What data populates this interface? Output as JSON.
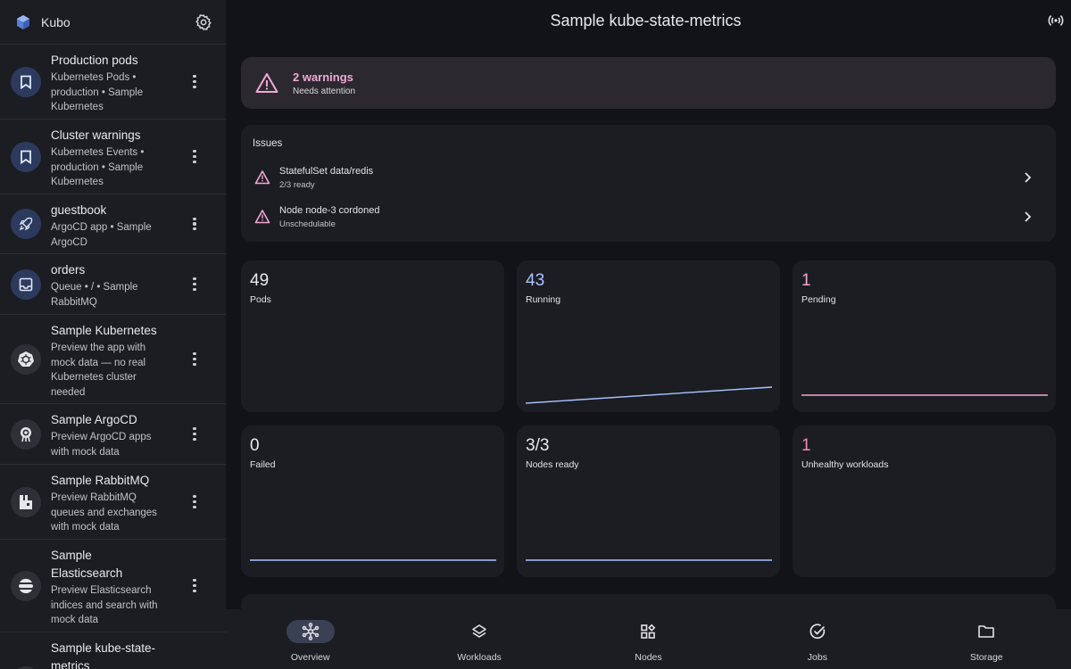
{
  "sidebar": {
    "app_name": "Kubo",
    "items": [
      {
        "title": "Production pods",
        "subtitle": "Kubernetes Pods • production • Sample Kubernetes",
        "icon": "bookmark-icon"
      },
      {
        "title": "Cluster warnings",
        "subtitle": "Kubernetes Events • production • Sample Kubernetes",
        "icon": "bookmark-icon"
      },
      {
        "title": "guestbook",
        "subtitle": "ArgoCD app • Sample ArgoCD",
        "icon": "rocket-icon"
      },
      {
        "title": "orders",
        "subtitle": "Queue • / • Sample RabbitMQ",
        "icon": "inbox-icon"
      },
      {
        "title": "Sample Kubernetes",
        "subtitle": "Preview the app with mock data — no real Kubernetes cluster needed",
        "icon": "kubernetes-icon"
      },
      {
        "title": "Sample ArgoCD",
        "subtitle": "Preview ArgoCD apps with mock data",
        "icon": "argocd-icon"
      },
      {
        "title": "Sample RabbitMQ",
        "subtitle": "Preview RabbitMQ queues and exchanges with mock data",
        "icon": "rabbitmq-icon"
      },
      {
        "title": "Sample Elasticsearch",
        "subtitle": "Preview Elasticsearch indices and search with mock data",
        "icon": "elasticsearch-icon"
      },
      {
        "title": "Sample kube-state-metrics",
        "subtitle": "",
        "icon": "metrics-icon"
      }
    ]
  },
  "header": {
    "title": "Sample kube-state-metrics"
  },
  "warning": {
    "title": "2 warnings",
    "subtitle": "Needs attention"
  },
  "issues": {
    "label": "Issues",
    "rows": [
      {
        "title": "StatefulSet data/redis",
        "subtitle": "2/3 ready"
      },
      {
        "title": "Node node-3 cordoned",
        "subtitle": "Unschedulable"
      }
    ]
  },
  "stats": [
    {
      "value": "49",
      "label": "Pods",
      "color": "#e9e8ee"
    },
    {
      "value": "43",
      "label": "Running",
      "color": "#a8c4ff"
    },
    {
      "value": "1",
      "label": "Pending",
      "color": "#f0a8d4"
    },
    {
      "value": "0",
      "label": "Failed",
      "color": "#e9e8ee"
    },
    {
      "value": "3/3",
      "label": "Nodes ready",
      "color": "#e9e8ee"
    },
    {
      "value": "1",
      "label": "Unhealthy workloads",
      "color": "#f08ca8"
    }
  ],
  "nav": {
    "items": [
      {
        "label": "Overview",
        "icon": "graph-icon",
        "active": true
      },
      {
        "label": "Workloads",
        "icon": "layers-icon",
        "active": false
      },
      {
        "label": "Nodes",
        "icon": "widgets-icon",
        "active": false
      },
      {
        "label": "Jobs",
        "icon": "check-circle-icon",
        "active": false
      },
      {
        "label": "Storage",
        "icon": "folder-icon",
        "active": false
      }
    ]
  },
  "colors": {
    "accent": "#a8c4ff",
    "warning": "#f0a8d4",
    "danger": "#f08ca8"
  }
}
